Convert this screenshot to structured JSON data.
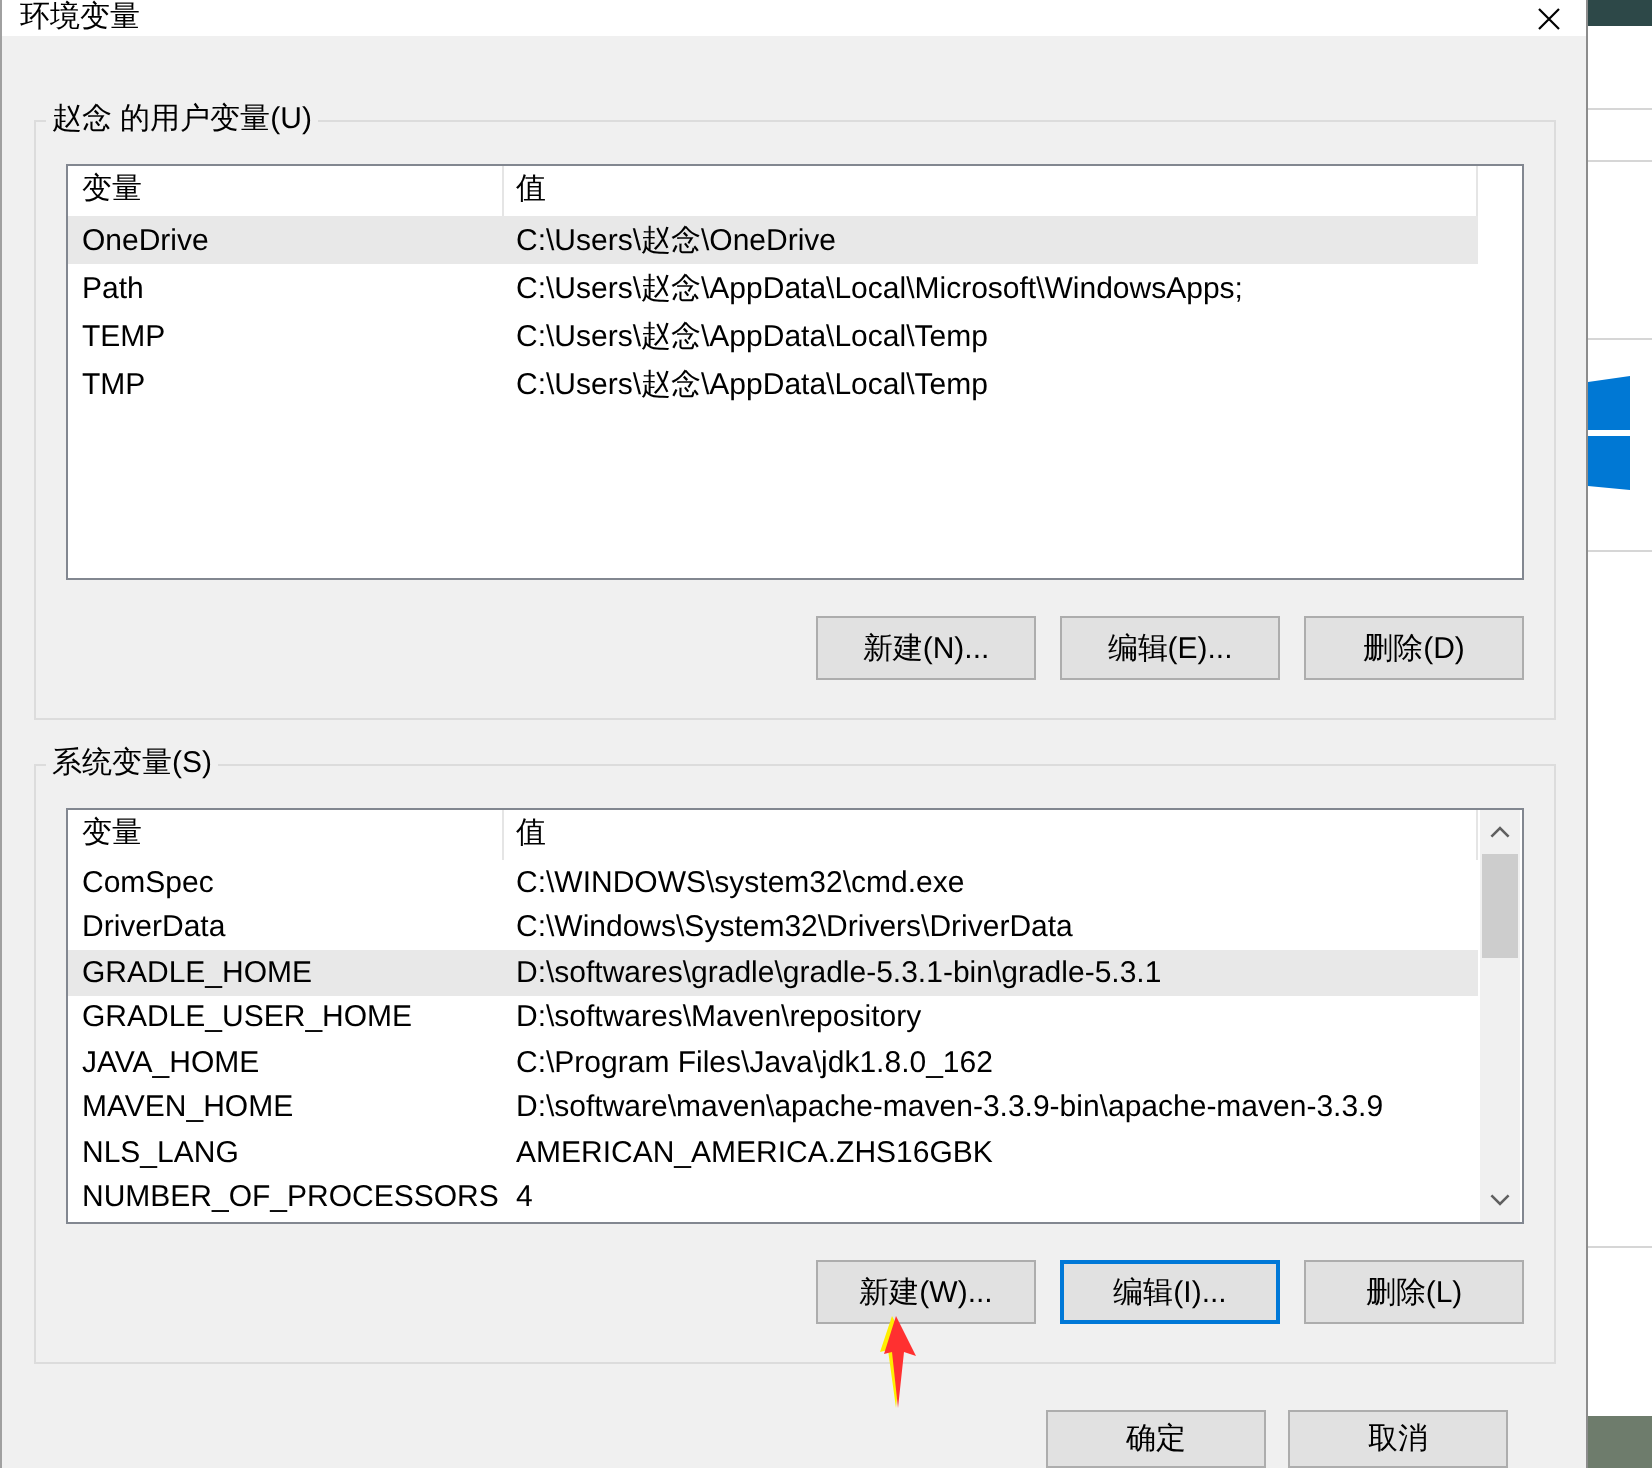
{
  "window": {
    "title": "环境变量"
  },
  "user_variables": {
    "title": "赵念 的用户变量(U)",
    "columns": [
      "变量",
      "值"
    ],
    "rows": [
      {
        "name": "OneDrive",
        "value": "C:\\Users\\赵念\\OneDrive",
        "selected": true
      },
      {
        "name": "Path",
        "value": "C:\\Users\\赵念\\AppData\\Local\\Microsoft\\WindowsApps;",
        "selected": false
      },
      {
        "name": "TEMP",
        "value": "C:\\Users\\赵念\\AppData\\Local\\Temp",
        "selected": false
      },
      {
        "name": "TMP",
        "value": "C:\\Users\\赵念\\AppData\\Local\\Temp",
        "selected": false
      }
    ],
    "buttons": [
      {
        "label": "新建(N)...",
        "focused": false
      },
      {
        "label": "编辑(E)...",
        "focused": false
      },
      {
        "label": "删除(D)",
        "focused": false
      }
    ]
  },
  "system_variables": {
    "title": "系统变量(S)",
    "columns": [
      "变量",
      "值"
    ],
    "scrollable": true,
    "rows": [
      {
        "name": "ComSpec",
        "value": "C:\\WINDOWS\\system32\\cmd.exe",
        "selected": false
      },
      {
        "name": "DriverData",
        "value": "C:\\Windows\\System32\\Drivers\\DriverData",
        "selected": false
      },
      {
        "name": "GRADLE_HOME",
        "value": "D:\\softwares\\gradle\\gradle-5.3.1-bin\\gradle-5.3.1",
        "selected": true
      },
      {
        "name": "GRADLE_USER_HOME",
        "value": "D:\\softwares\\Maven\\repository",
        "selected": false
      },
      {
        "name": "JAVA_HOME",
        "value": "C:\\Program Files\\Java\\jdk1.8.0_162",
        "selected": false
      },
      {
        "name": "MAVEN_HOME",
        "value": "D:\\software\\maven\\apache-maven-3.3.9-bin\\apache-maven-3.3.9",
        "selected": false
      },
      {
        "name": "NLS_LANG",
        "value": "AMERICAN_AMERICA.ZHS16GBK",
        "selected": false
      },
      {
        "name": "NUMBER_OF_PROCESSORS",
        "value": "4",
        "selected": false
      }
    ],
    "buttons": [
      {
        "label": "新建(W)...",
        "focused": false
      },
      {
        "label": "编辑(I)...",
        "focused": true
      },
      {
        "label": "删除(L)",
        "focused": false
      }
    ]
  },
  "footer_buttons": [
    {
      "label": "确定",
      "focused": false
    },
    {
      "label": "取消",
      "focused": false
    }
  ]
}
